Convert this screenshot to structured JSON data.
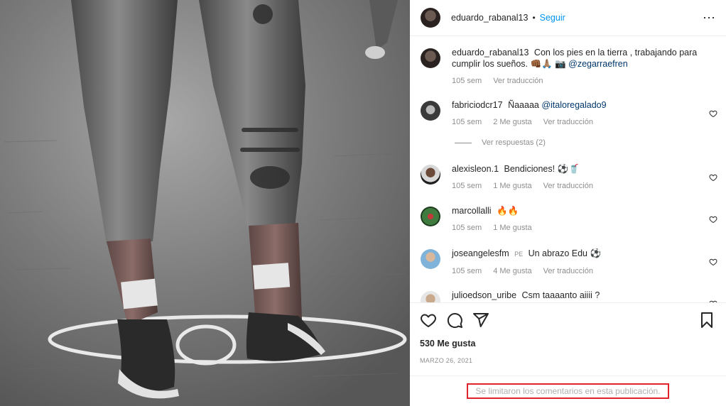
{
  "post": {
    "author": "eduardo_rabanal13",
    "follow_label": "Seguir",
    "separator": "•",
    "more_icon": "⋯"
  },
  "caption": {
    "author": "eduardo_rabanal13",
    "text": "Con los pies en la tierra , trabajando para cumplir los sueños. 👊🏾🙏🏽 📷",
    "mention": "@zegarraefren",
    "time": "105 sem",
    "translate": "Ver traducción"
  },
  "comments": [
    {
      "user": "fabriciodcr17",
      "text": "Ñaaaaa",
      "mention": "@italoregalado9",
      "time": "105 sem",
      "likes": "2 Me gusta",
      "translate": "Ver traducción"
    },
    {
      "user": "alexisleon.1",
      "text": "Bendiciones! ⚽🥤",
      "time": "105 sem",
      "likes": "1 Me gusta",
      "translate": "Ver traducción"
    },
    {
      "user": "marcollalli",
      "text": "🔥🔥",
      "time": "105 sem",
      "likes": "1 Me gusta"
    },
    {
      "user": "joseangelesfm",
      "badge": "PE",
      "text": "Un abrazo Edu ⚽",
      "time": "105 sem",
      "likes": "4 Me gusta",
      "translate": "Ver traducción"
    },
    {
      "user": "julioedson_uribe",
      "text": "Csm taaaanto aiiii ?"
    }
  ],
  "replies_label": "Ver respuestas (2)",
  "likes_count": "530 Me gusta",
  "date": "MARZO 26, 2021",
  "comments_limited": "Se limitaron los comentarios en esta publicación.",
  "colors": {
    "accent": "#0095f6",
    "mention": "#00376b",
    "highlight": "#e0242c",
    "muted": "#8e8e8e"
  }
}
